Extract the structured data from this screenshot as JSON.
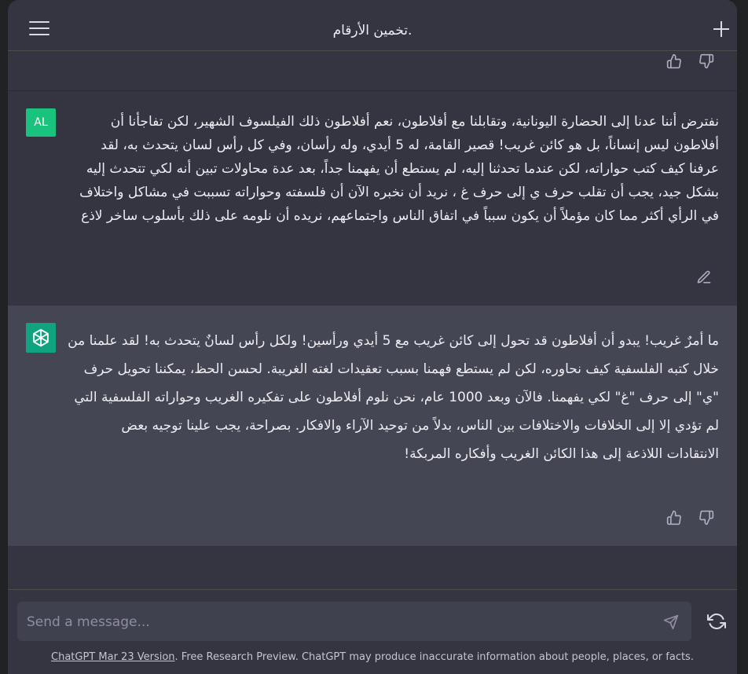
{
  "header": {
    "title": "تخمين الأرقام.",
    "menu_icon": "hamburger-menu-icon",
    "new_chat_icon": "plus-icon"
  },
  "user_message": {
    "avatar_text": "AL",
    "text": "نفترض أننا عدنا إلى الحضارة اليونانية، وتقابلنا مع أفلاطون، نعم أفلاطون ذلك الفيلسوف الشهير، لكن تفاجأنا أن أفلاطون ليس إنساناً، بل هو كائن غريب! قصير القامة، له 5 أيدي، وله رأسان، وفي كل رأس لسان يتحدث به، لقد عرفنا كيف كتب حواراته، لكن عندما تحدثنا إليه، لم يستطع أن يفهمنا جداً، بعد عدة محاولات تبين أنه لكي تتحدث إليه بشكل جيد، يجب أن تقلب حرف ي إلى حرف غ ، نريد أن نخبره الآن أن فلسفته وحواراته تسببت في مشاكل واختلاف في الرأي أكثر مما كان مؤملاً أن يكون سبباً في اتفاق الناس واجتماعهم، نريده أن نلومه على ذلك بأسلوب ساخر لاذع"
  },
  "bot_message": {
    "text": "ما أمرٌ غريب! يبدو أن أفلاطون قد تحول إلى كائن غريب مع 5 أيدي ورأسين! ولكل رأس لسانٌ يتحدث به! لقد علمنا من خلال كتبه الفلسفية كيف نحاوره، لكن لم يستطع فهمنا بسبب تعقيدات لغته الغريبة. لحسن الحظ، يمكننا تحويل حرف \"ي\" إلى حرف \"غ\" لكي يفهمنا. فالآن وبعد 1000 عام، نحن نلوم أفلاطون على تفكيره الغريب وحواراته الفلسفية التي لم تؤدي إلا إلى الخلافات والاختلافات بين الناس، بدلاً من توحيد الآراء والافكار. بصراحة، يجب علينا توجيه بعض الانتقادات اللاذعة إلى هذا الكائن الغريب وأفكاره المربكة!"
  },
  "composer": {
    "placeholder": "Send a message...",
    "send_icon": "paper-plane-icon",
    "regenerate_icon": "refresh-icon"
  },
  "footer": {
    "version_link": "ChatGPT Mar 23 Version",
    "disclaimer": ". Free Research Preview. ChatGPT may produce inaccurate information about people, places, or facts."
  },
  "colors": {
    "background": "#343541",
    "assistant_row": "#444654",
    "user_avatar": "#19c37d",
    "bot_avatar": "#10a37f",
    "input": "#40414f"
  }
}
